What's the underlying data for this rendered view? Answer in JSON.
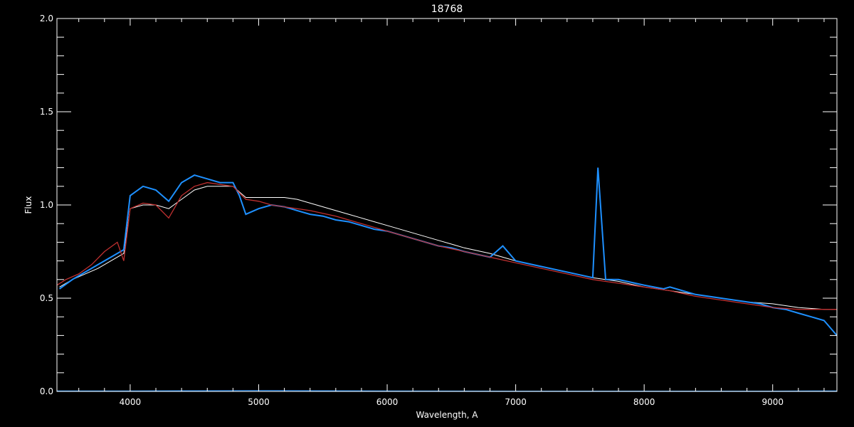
{
  "chart_data": {
    "type": "line",
    "title": "18768",
    "xlabel": "Wavelength, A",
    "ylabel": "Flux",
    "xlim": [
      3430,
      9500
    ],
    "ylim": [
      0.0,
      2.0
    ],
    "x_ticks": [
      4000,
      5000,
      6000,
      7000,
      8000,
      9000
    ],
    "x_tick_labels": [
      "4000",
      "5000",
      "6000",
      "7000",
      "8000",
      "9000"
    ],
    "y_ticks": [
      0.0,
      0.5,
      1.0,
      1.5,
      2.0
    ],
    "y_tick_labels": [
      "0.0",
      "0.5",
      "1.0",
      "1.5",
      "2.0"
    ],
    "grid": false,
    "colors": {
      "background": "#000000",
      "axes": "#ffffff",
      "observed": "#ffffff",
      "template": "#1e90ff",
      "fit": "#c03030",
      "error": "#1e90ff"
    },
    "series": [
      {
        "role": "observed",
        "x": [
          3450,
          3550,
          3650,
          3750,
          3850,
          3950,
          4000,
          4100,
          4200,
          4300,
          4400,
          4500,
          4600,
          4700,
          4800,
          4850,
          4900,
          5000,
          5100,
          5200,
          5300,
          5400,
          5500,
          5600,
          5700,
          5800,
          5900,
          6000,
          6200,
          6400,
          6500,
          6600,
          6800,
          7000,
          7200,
          7400,
          7600,
          7800,
          8000,
          8200,
          8400,
          8600,
          8800,
          9000,
          9200,
          9400,
          9500
        ],
        "y": [
          0.56,
          0.6,
          0.63,
          0.66,
          0.7,
          0.74,
          0.98,
          1.0,
          1.0,
          0.98,
          1.03,
          1.08,
          1.1,
          1.1,
          1.1,
          1.07,
          1.04,
          1.04,
          1.04,
          1.04,
          1.03,
          1.01,
          0.99,
          0.97,
          0.95,
          0.93,
          0.91,
          0.89,
          0.85,
          0.81,
          0.79,
          0.77,
          0.74,
          0.7,
          0.67,
          0.64,
          0.61,
          0.59,
          0.56,
          0.54,
          0.52,
          0.5,
          0.48,
          0.47,
          0.45,
          0.44,
          0.44
        ]
      },
      {
        "role": "template",
        "x": [
          3450,
          3550,
          3650,
          3750,
          3850,
          3950,
          4000,
          4100,
          4200,
          4300,
          4400,
          4500,
          4600,
          4700,
          4800,
          4850,
          4900,
          5000,
          5100,
          5200,
          5300,
          5400,
          5500,
          5600,
          5700,
          5800,
          5900,
          6000,
          6200,
          6400,
          6500,
          6600,
          6800,
          6900,
          7000,
          7200,
          7400,
          7600,
          7640,
          7700,
          7800,
          8000,
          8150,
          8200,
          8400,
          8600,
          8800,
          8900,
          9000,
          9100,
          9200,
          9300,
          9400,
          9500
        ],
        "y": [
          0.55,
          0.6,
          0.64,
          0.68,
          0.72,
          0.76,
          1.05,
          1.1,
          1.08,
          1.02,
          1.12,
          1.16,
          1.14,
          1.12,
          1.12,
          1.05,
          0.95,
          0.98,
          1.0,
          0.99,
          0.97,
          0.95,
          0.94,
          0.92,
          0.91,
          0.89,
          0.87,
          0.86,
          0.82,
          0.78,
          0.77,
          0.75,
          0.72,
          0.78,
          0.7,
          0.67,
          0.64,
          0.61,
          1.2,
          0.6,
          0.6,
          0.57,
          0.55,
          0.56,
          0.52,
          0.5,
          0.48,
          0.47,
          0.45,
          0.44,
          0.42,
          0.4,
          0.38,
          0.3
        ]
      },
      {
        "role": "fit",
        "x": [
          3430,
          3500,
          3600,
          3700,
          3800,
          3900,
          3950,
          4000,
          4100,
          4200,
          4300,
          4400,
          4500,
          4600,
          4700,
          4800,
          4900,
          5000,
          5100,
          5200,
          5400,
          5600,
          5800,
          6000,
          6200,
          6400,
          6600,
          6800,
          7000,
          7200,
          7400,
          7600,
          7800,
          8000,
          8200,
          8400,
          8600,
          8800,
          9000,
          9200,
          9400,
          9500
        ],
        "y": [
          0.57,
          0.6,
          0.63,
          0.68,
          0.75,
          0.8,
          0.7,
          0.98,
          1.01,
          1.0,
          0.93,
          1.05,
          1.1,
          1.12,
          1.11,
          1.1,
          1.03,
          1.02,
          1.0,
          0.99,
          0.97,
          0.94,
          0.9,
          0.86,
          0.82,
          0.78,
          0.75,
          0.72,
          0.69,
          0.66,
          0.63,
          0.6,
          0.58,
          0.56,
          0.54,
          0.51,
          0.49,
          0.47,
          0.45,
          0.44,
          0.44,
          0.44
        ]
      },
      {
        "role": "error",
        "x": [
          3430,
          4000,
          4500,
          5000,
          5500,
          6000,
          7000,
          8000,
          9000,
          9500
        ],
        "y": [
          0.003,
          0.003,
          0.004,
          0.005,
          0.004,
          0.003,
          0.002,
          0.002,
          0.002,
          0.003
        ]
      }
    ]
  }
}
